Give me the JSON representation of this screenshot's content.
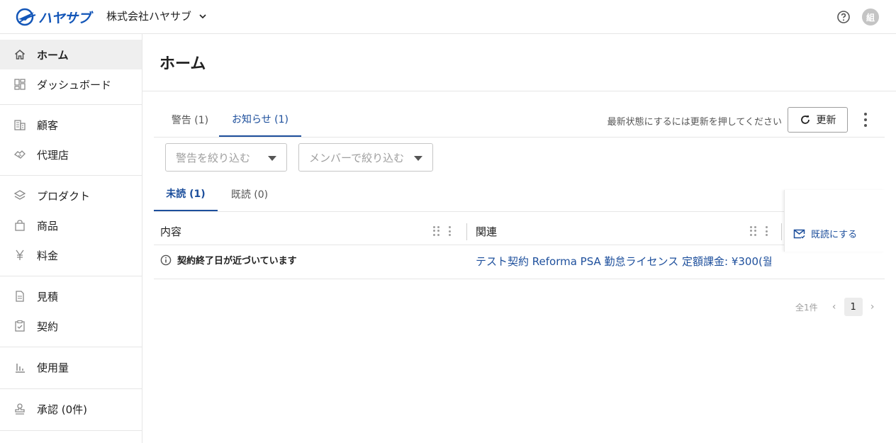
{
  "header": {
    "logo_text": "ハヤサブ",
    "org_name": "株式会社ハヤサブ",
    "avatar_text": "組",
    "brand_color": "#1356b8",
    "icons": [
      "logo-icon",
      "chevron-down-icon",
      "help-icon"
    ]
  },
  "sidebar": {
    "items": [
      {
        "label": "ホーム",
        "icon": "home-icon",
        "active": true
      },
      {
        "label": "ダッシュボード",
        "icon": "dashboard-icon"
      },
      {
        "label": "顧客",
        "icon": "building-icon"
      },
      {
        "label": "代理店",
        "icon": "handshake-icon"
      },
      {
        "label": "プロダクト",
        "icon": "layers-icon"
      },
      {
        "label": "商品",
        "icon": "bag-icon"
      },
      {
        "label": "料金",
        "icon": "yen-icon"
      },
      {
        "label": "見積",
        "icon": "document-icon"
      },
      {
        "label": "契約",
        "icon": "clipboard-check-icon"
      },
      {
        "label": "使用量",
        "icon": "bar-chart-icon"
      },
      {
        "label": "承認 (0件)",
        "icon": "stamp-icon"
      }
    ]
  },
  "main": {
    "title": "ホーム",
    "tabs": [
      {
        "label": "警告 (1)",
        "active": false
      },
      {
        "label": "お知らせ (1)",
        "active": true
      }
    ],
    "refresh_hint": "最新状態にするには更新を押してください",
    "refresh_label": "更新",
    "filters": [
      {
        "placeholder": "警告を絞り込む"
      },
      {
        "placeholder": "メンバーで絞り込む"
      }
    ],
    "subtabs": [
      {
        "label": "未読 (1)",
        "active": true
      },
      {
        "label": "既読 (0)",
        "active": false
      }
    ],
    "table": {
      "columns": [
        "内容",
        "関連"
      ],
      "rows": [
        {
          "content": "契約終了日が近づいています",
          "related": "テスト契約  Reforma PSA 勤怠ライセンス 定額課金: ¥300(월",
          "action": "既読にする"
        }
      ]
    },
    "pagination": {
      "total": "全1件",
      "current": "1",
      "prev": "‹",
      "next": "›"
    },
    "accent_color": "#1d4f9c"
  }
}
